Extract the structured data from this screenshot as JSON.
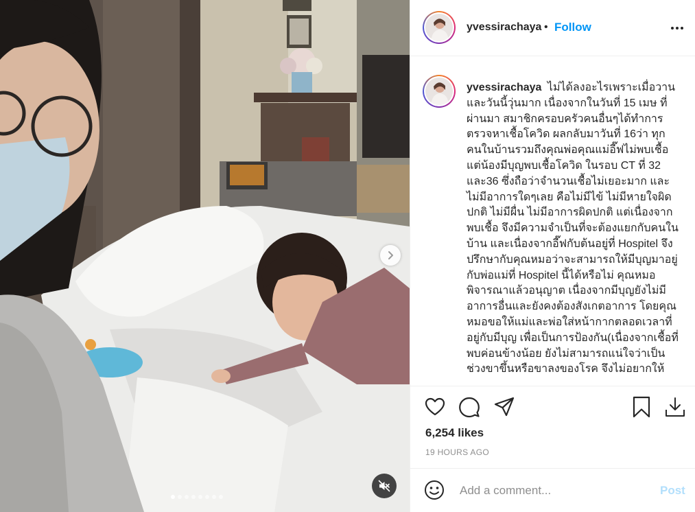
{
  "post": {
    "username": "yvessirachaya",
    "separator": "•",
    "follow_label": "Follow",
    "caption_text": "ไม่ได้ลงอะไรเพราะเมื่อวานและวันนี้วุ่นมาก เนื่องจากในวันที่ 15 เมษ ที่ผ่านมา สมาชิกครอบครัวคนอื่นๆได้ทำการตรวจหาเชื้อโควิด ผลกลับมาวันที่ 16ว่า ทุกคนในบ้านรวมถึงคุณพ่อคุณแม่อี๊ฟไม่พบเชื้อ แต่น้องมีบุญพบเชื้อโควิด ในรอบ CT ที่ 32 และ36 ซึ่งถือว่าจำนวนเชื้อไม่เยอะมาก และไม่มีอาการใดๆเลย คือไม่มีไข้ ไม่มีหายใจผิดปกติ ไม่มีผื่น ไม่มีอาการผิดปกติ แต่เนื่องจากพบเชื้อ จึงมีความจำเป็นที่จะต้องแยกกับคนในบ้าน และเนื่องจากอี๊ฟกับต้นอยู่ที่ Hospitel จึงปรึกษากับคุณหมอว่าจะสามารถให้มีบุญมาอยู่กับพ่อแม่ที่ Hospitel นี้ได้หรือไม่ คุณหมอพิจารณาแล้วอนุญาต เนื่องจากมีบุญยังไม่มีอาการอื่นและยังคงต้องสังเกตอาการ โดยคุณหมอขอให้แม่และพ่อใส่หน้ากากตลอดเวลาที่อยู่กับมีบุญ เพื่อเป็นการป้องกัน(เนื่องจากเชื้อที่พบค่อนข้างน้อย ยังไม่สามารถแน่ใจว่าเป็นช่วงขาขึ้นหรือขาลงของโรค จึงไม่อยากให้",
    "likes_text": "6,254 likes",
    "time_text": "19 HOURS AGO",
    "comment_placeholder": "Add a comment...",
    "post_label": "Post"
  },
  "media": {
    "carousel_count": 8,
    "carousel_active": 1
  },
  "icons": {
    "more": "more-horizontal-icon",
    "like": "heart-icon",
    "comment": "comment-bubble-icon",
    "share": "paper-plane-icon",
    "save": "bookmark-icon",
    "download": "download-icon",
    "emoji": "smiley-icon",
    "next": "chevron-right-icon",
    "mute": "speaker-muted-icon"
  },
  "colors": {
    "accent": "#0095f6",
    "post_disabled": "#b2dffc",
    "muted_text": "#8e8e8e",
    "text": "#262626"
  }
}
